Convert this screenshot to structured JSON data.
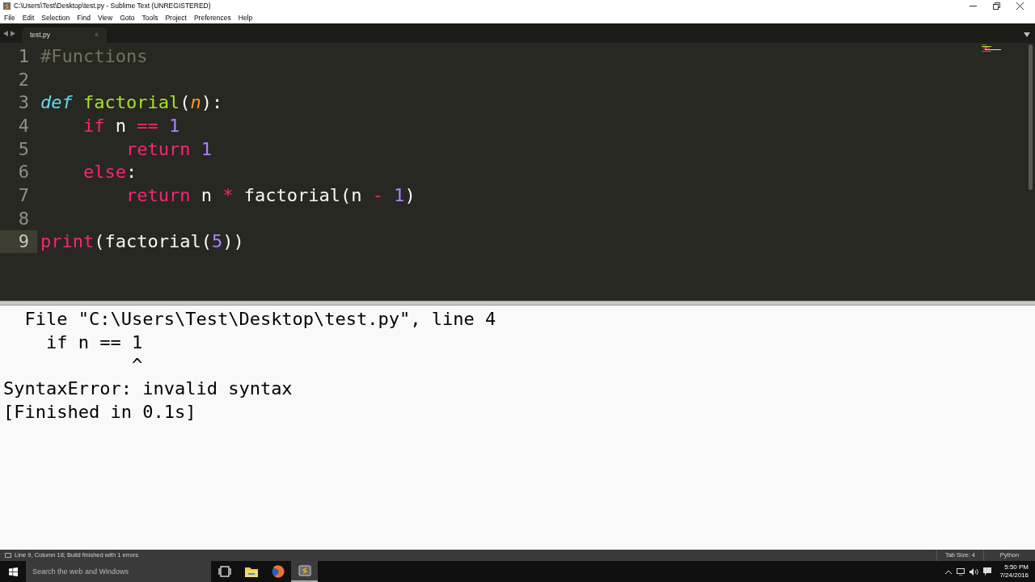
{
  "window": {
    "title": "C:\\Users\\Test\\Desktop\\test.py - Sublime Text (UNREGISTERED)"
  },
  "menu": [
    "File",
    "Edit",
    "Selection",
    "Find",
    "View",
    "Goto",
    "Tools",
    "Project",
    "Preferences",
    "Help"
  ],
  "tabs": [
    {
      "label": "test.py",
      "selected": true,
      "close": "×"
    }
  ],
  "editor": {
    "lines": [
      {
        "number": "1",
        "current": false,
        "tokens": [
          {
            "text": "#Functions",
            "kind": "comment"
          }
        ]
      },
      {
        "number": "2",
        "current": false
      },
      {
        "number": "3",
        "current": false,
        "tokens": [
          {
            "text": "def",
            "kind": "storage"
          },
          {
            "text": " factorial",
            "kind": "function"
          },
          {
            "text": "(",
            "kind": "plain"
          },
          {
            "text": "n",
            "kind": "param"
          },
          {
            "text": "):",
            "kind": "plain"
          }
        ]
      },
      {
        "number": "4",
        "current": false,
        "tokens": [
          {
            "text": "    if",
            "kind": "keyword"
          },
          {
            "text": " n ",
            "kind": "plain"
          },
          {
            "text": "==",
            "kind": "operator"
          },
          {
            "text": " 1",
            "kind": "number"
          }
        ]
      },
      {
        "number": "5",
        "current": false,
        "tokens": [
          {
            "text": "        return",
            "kind": "keyword"
          },
          {
            "text": " 1",
            "kind": "number"
          }
        ]
      },
      {
        "number": "6",
        "current": false,
        "tokens": [
          {
            "text": "    else",
            "kind": "keyword"
          },
          {
            "text": ":",
            "kind": "plain"
          }
        ]
      },
      {
        "number": "7",
        "current": false,
        "tokens": [
          {
            "text": "        return",
            "kind": "keyword"
          },
          {
            "text": " n ",
            "kind": "plain"
          },
          {
            "text": "*",
            "kind": "operator"
          },
          {
            "text": " factorial(n ",
            "kind": "plain"
          },
          {
            "text": "-",
            "kind": "operator"
          },
          {
            "text": " 1",
            "kind": "number"
          },
          {
            "text": ")",
            "kind": "plain"
          }
        ]
      },
      {
        "number": "8",
        "current": false
      },
      {
        "number": "9",
        "current": true,
        "tokens": [
          {
            "text": "print",
            "kind": "keyword"
          },
          {
            "text": "(factorial(",
            "kind": "plain"
          },
          {
            "text": "5",
            "kind": "number"
          },
          {
            "text": "))",
            "kind": "plain"
          }
        ]
      }
    ]
  },
  "output": {
    "lines": [
      "  File \"C:\\Users\\Test\\Desktop\\test.py\", line 4",
      "    if n == 1",
      "            ^",
      "SyntaxError: invalid syntax",
      "[Finished in 0.1s]"
    ]
  },
  "status_bar": {
    "message": "Line 9, Column 18; Build finished with 1 errors",
    "tab_size": "Tab Size: 4",
    "syntax": "Python"
  },
  "taskbar": {
    "search": {
      "placeholder": "Search the web and Windows"
    },
    "apps": [
      {
        "kind": "taskview",
        "selected": false
      },
      {
        "kind": "explorer",
        "selected": false
      },
      {
        "kind": "browser",
        "selected": false
      },
      {
        "kind": "editor",
        "selected": true
      }
    ],
    "clock": {
      "time": "5:50 PM",
      "date": "7/24/2016"
    }
  }
}
